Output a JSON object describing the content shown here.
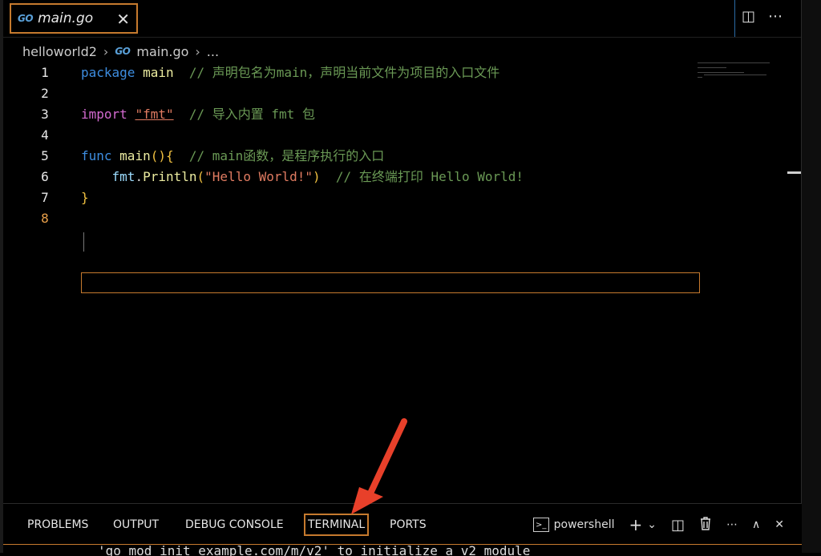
{
  "tab": {
    "logo": "GO",
    "label": "main.go",
    "close": "✕"
  },
  "tab_actions": {
    "split": "◫",
    "more": "⋯"
  },
  "breadcrumb": {
    "folder": "helloworld2",
    "logo": "GO",
    "file": "main.go",
    "more": "..."
  },
  "editor": {
    "line_numbers": [
      "1",
      "2",
      "3",
      "4",
      "5",
      "6",
      "7",
      "8"
    ],
    "lines": [
      {
        "parts": [
          [
            "kw",
            "package"
          ],
          [
            "plain",
            " "
          ],
          [
            "fn",
            "main"
          ],
          [
            "plain",
            "  "
          ],
          [
            "cm",
            "// 声明包名为main，声明当前文件为项目的入口文件"
          ]
        ]
      },
      {
        "parts": []
      },
      {
        "parts": [
          [
            "kw2",
            "import"
          ],
          [
            "plain",
            " "
          ],
          [
            "str",
            "\"fmt\""
          ],
          [
            "plain",
            "  "
          ],
          [
            "cm",
            "// 导入内置 fmt 包"
          ]
        ]
      },
      {
        "parts": []
      },
      {
        "parts": [
          [
            "kw",
            "func"
          ],
          [
            "plain",
            " "
          ],
          [
            "fn",
            "main"
          ],
          [
            "brace",
            "(){"
          ],
          [
            "plain",
            "  "
          ],
          [
            "cm",
            "// main函数，是程序执行的入口"
          ]
        ]
      },
      {
        "parts": [
          [
            "plain",
            "    "
          ],
          [
            "id",
            "fmt"
          ],
          [
            "plain",
            "."
          ],
          [
            "fn",
            "Println"
          ],
          [
            "brace",
            "("
          ],
          [
            "str",
            "\"Hello World!\""
          ],
          [
            "brace",
            ")"
          ],
          [
            "plain",
            "  "
          ],
          [
            "cm",
            "// 在终端打印 Hello World!"
          ]
        ]
      },
      {
        "parts": [
          [
            "brace",
            "}"
          ]
        ]
      },
      {
        "parts": []
      }
    ]
  },
  "panel": {
    "tabs": [
      "PROBLEMS",
      "OUTPUT",
      "DEBUG CONSOLE",
      "TERMINAL",
      "PORTS"
    ],
    "active_tab": "TERMINAL",
    "shell": "powershell",
    "actions": {
      "add": "+",
      "dropdown": "⌄",
      "split": "◫",
      "trash": "🗑",
      "more": "⋯",
      "maximize": "∧",
      "close": "✕"
    },
    "terminal_text": "'go mod init example.com/m/v2' to initialize a v2 module"
  },
  "colors": {
    "accent": "#c67a2e",
    "arrow": "#e8402a"
  }
}
